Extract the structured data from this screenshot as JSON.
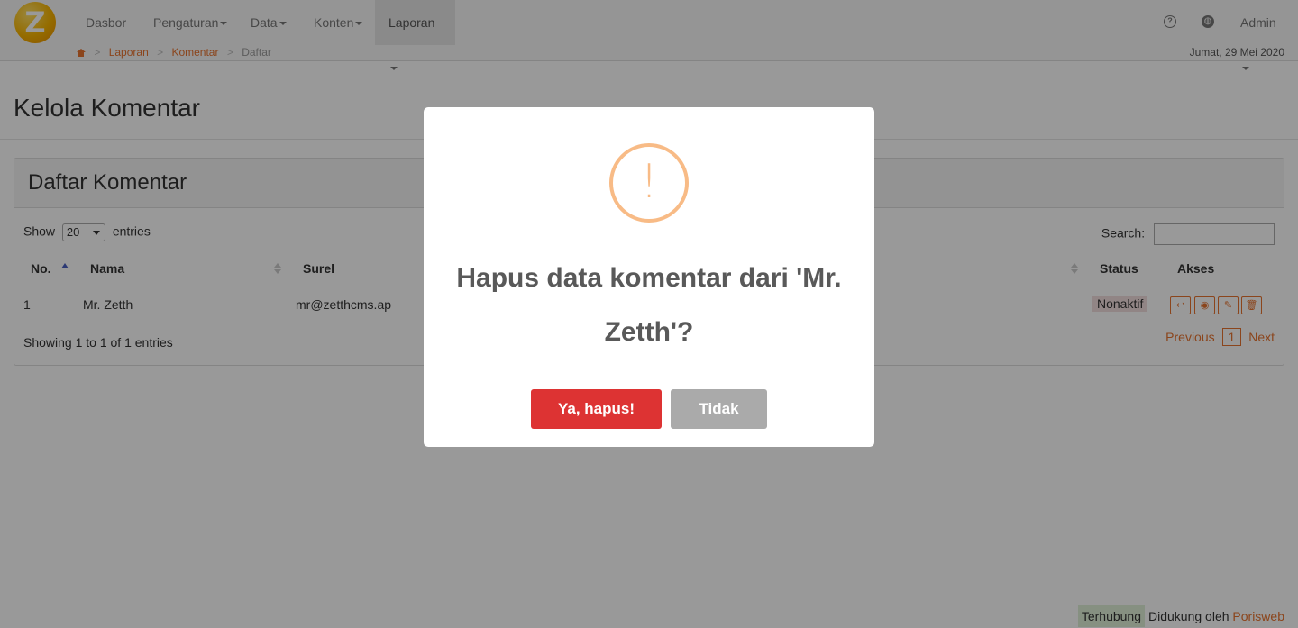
{
  "navbar": {
    "logo_letter": "Z",
    "items": [
      {
        "label": "Dasbor",
        "dropdown": false
      },
      {
        "label": "Pengaturan",
        "dropdown": true
      },
      {
        "label": "Data",
        "dropdown": true
      },
      {
        "label": "Konten",
        "dropdown": true
      },
      {
        "label": "Laporan",
        "dropdown": true,
        "active": true
      }
    ],
    "right": {
      "help_icon": "question-circle-icon",
      "globe_icon": "globe-icon",
      "user_label": "Admin"
    }
  },
  "breadcrumb": {
    "home_icon": "home-icon",
    "items": [
      "Laporan",
      "Komentar",
      "Daftar"
    ],
    "date": "Jumat, 29 Mei 2020"
  },
  "page": {
    "title": "Kelola Komentar",
    "panel_title": "Daftar Komentar"
  },
  "table_controls": {
    "show_label": "Show",
    "entries_value": "20",
    "entries_label": "entries",
    "search_label": "Search:",
    "search_value": ""
  },
  "table": {
    "columns": [
      "No.",
      "Nama",
      "Surel",
      "Status",
      "Akses"
    ],
    "rows": [
      {
        "no": "1",
        "nama": "Mr. Zetth",
        "surel": "mr@zetthcms.ap",
        "status": "Nonaktif"
      }
    ],
    "row_actions": [
      "reply-icon",
      "eye-icon",
      "edit-icon",
      "trash-icon"
    ]
  },
  "table_footer": {
    "info": "Showing 1 to 1 of 1 entries",
    "previous": "Previous",
    "page": "1",
    "next": "Next"
  },
  "footer": {
    "status": "Terhubung",
    "powered_prefix": "Didukung oleh",
    "powered_brand": "Porisweb"
  },
  "modal": {
    "icon": "warning-icon",
    "icon_glyph": "!",
    "title": "Hapus data komentar dari 'Mr. Zetth'?",
    "confirm_label": "Ya, hapus!",
    "cancel_label": "Tidak",
    "colors": {
      "confirm": "#dd3333",
      "cancel": "#aaaaaa",
      "warning": "#f8bb86",
      "accent": "#e8732f"
    }
  }
}
